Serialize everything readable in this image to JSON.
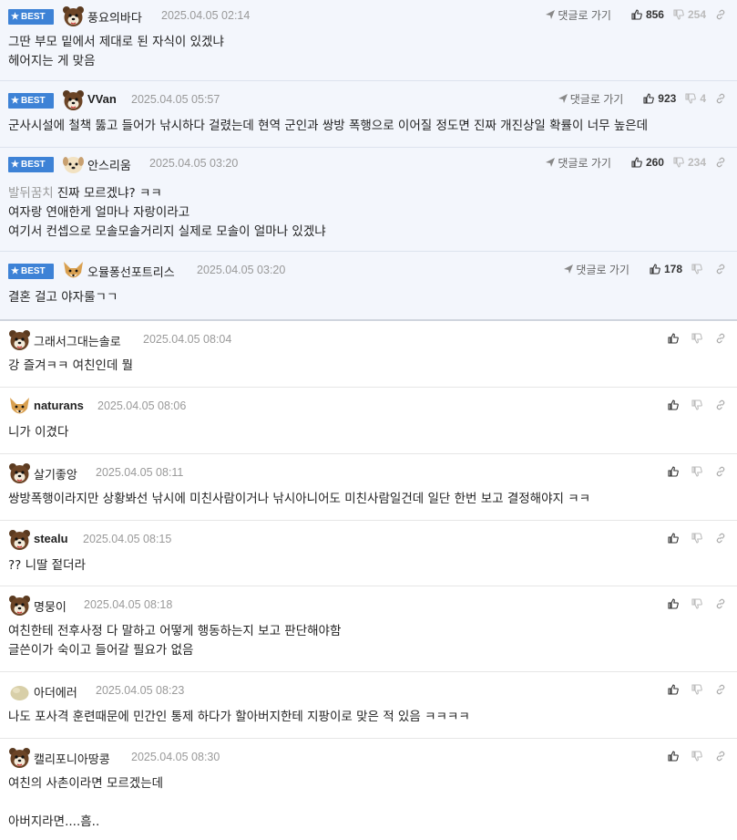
{
  "labels": {
    "best": "BEST",
    "reply_link": "댓글로 가기"
  },
  "colors": {
    "best_badge": "#3d82d6",
    "best_row_bg": "#f3f6fc",
    "date_text": "#999999",
    "mention_text": "#999999"
  },
  "best_comments": [
    {
      "nick": "풍요의바다",
      "date": "2025.04.05 02:14",
      "up": "856",
      "down": "254",
      "avatar": "bear-avatar",
      "lines": [
        "그딴 부모 밑에서 제대로 된 자식이 있겠냐",
        "헤어지는 게 맞음"
      ]
    },
    {
      "nick": "VVan",
      "date": "2025.04.05 05:57",
      "up": "923",
      "down": "4",
      "avatar": "bear-avatar",
      "lines": [
        "군사시설에 철책 뚫고 들어가 낚시하다 걸렸는데 현역 군인과 쌍방 폭행으로 이어질 정도면 진짜 개진상일 확률이 너무 높은데"
      ]
    },
    {
      "nick": "안스리움",
      "date": "2025.04.05 03:20",
      "up": "260",
      "down": "234",
      "avatar": "dog-avatar",
      "mention": "발뒤꿈치",
      "lines": [
        "진짜 모르겠냐? ㅋㅋ",
        "여자랑 연애한게 얼마나 자랑이라고",
        "여기서 컨셉으로 모솔모솔거리지 실제로 모솔이 얼마나 있겠냐"
      ]
    },
    {
      "nick": "오뮬퐁선포트리스",
      "date": "2025.04.05 03:20",
      "up": "178",
      "down": "",
      "avatar": "fox-avatar",
      "lines": [
        "결혼 걸고 야자룰ㄱㄱ"
      ]
    }
  ],
  "comments": [
    {
      "nick": "그래서그대는솔로",
      "date": "2025.04.05 08:04",
      "avatar": "bear-avatar",
      "lines": [
        "강 즐겨ㅋㅋ 여친인데 뭘"
      ]
    },
    {
      "nick": "naturans",
      "date": "2025.04.05 08:06",
      "avatar": "fox-avatar",
      "lines": [
        "니가 이겼다"
      ]
    },
    {
      "nick": "살기좋앙",
      "date": "2025.04.05 08:11",
      "avatar": "bear-avatar",
      "lines": [
        "쌍방폭행이라지만 상황봐선 낚시에 미친사람이거나 낚시아니어도 미친사람일건데 일단 한번 보고 결정해야지 ㅋㅋ"
      ]
    },
    {
      "nick": "stealu",
      "date": "2025.04.05 08:15",
      "avatar": "bear-avatar",
      "lines": [
        "?? 니딸 젙더라"
      ]
    },
    {
      "nick": "명뭉이",
      "date": "2025.04.05 08:18",
      "avatar": "bear-avatar",
      "lines": [
        "여친한테 전후사정 다 말하고 어떻게 행동하는지 보고 판단해야함",
        "글쓴이가 숙이고 들어갈 필요가 없음"
      ]
    },
    {
      "nick": "아더에러",
      "date": "2025.04.05 08:23",
      "avatar": "blob-avatar",
      "lines": [
        "나도 포사격 훈련때문에 민간인 통제 하다가 할아버지한테 지팡이로 맞은 적 있음 ㅋㅋㅋㅋ"
      ]
    },
    {
      "nick": "캘리포니아땅콩",
      "date": "2025.04.05 08:30",
      "avatar": "bear-avatar",
      "lines": [
        "여친의 사촌이라면 모르겠는데",
        "",
        "아버지라면....흠.."
      ]
    }
  ]
}
